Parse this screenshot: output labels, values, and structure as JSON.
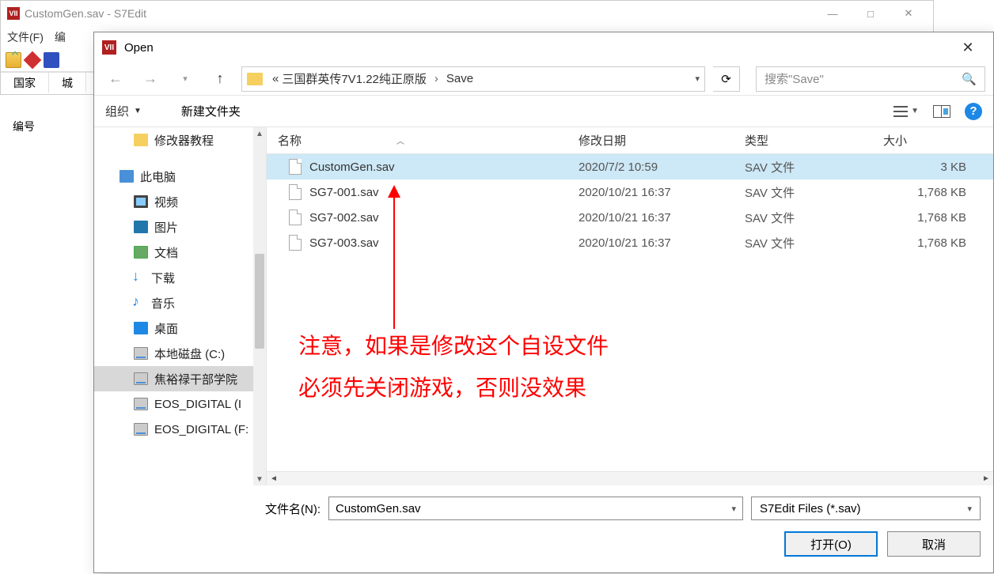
{
  "bg": {
    "title": "CustomGen.sav - S7Edit",
    "menu": {
      "file": "文件(F)",
      "edit": "编"
    },
    "tabs": {
      "t1": "国家",
      "t2": "城"
    },
    "row2": "编号"
  },
  "dialog": {
    "title": "Open",
    "breadcrumb": {
      "prefix": "«",
      "part1": "三国群英传7V1.22纯正原版",
      "part2": "Save"
    },
    "search_placeholder": "搜索\"Save\"",
    "toolbar": {
      "organize": "组织",
      "new_folder": "新建文件夹"
    },
    "tree": {
      "items": [
        {
          "label": "修改器教程",
          "icon": "folder",
          "indent": 2
        },
        {
          "label": "此电脑",
          "icon": "pc",
          "indent": 1
        },
        {
          "label": "视频",
          "icon": "video",
          "indent": 2
        },
        {
          "label": "图片",
          "icon": "pic",
          "indent": 2
        },
        {
          "label": "文档",
          "icon": "doc",
          "indent": 2
        },
        {
          "label": "下载",
          "icon": "dl",
          "indent": 2
        },
        {
          "label": "音乐",
          "icon": "music",
          "indent": 2
        },
        {
          "label": "桌面",
          "icon": "desk",
          "indent": 2
        },
        {
          "label": "本地磁盘 (C:)",
          "icon": "drive",
          "indent": 2
        },
        {
          "label": "焦裕禄干部学院",
          "icon": "drive",
          "indent": 2,
          "sel": true
        },
        {
          "label": "EOS_DIGITAL (I",
          "icon": "drive",
          "indent": 2
        },
        {
          "label": "EOS_DIGITAL (F:",
          "icon": "drive",
          "indent": 2
        }
      ]
    },
    "columns": {
      "name": "名称",
      "date": "修改日期",
      "type": "类型",
      "size": "大小"
    },
    "files": [
      {
        "name": "CustomGen.sav",
        "date": "2020/7/2 10:59",
        "type": "SAV 文件",
        "size": "3 KB",
        "sel": true
      },
      {
        "name": "SG7-001.sav",
        "date": "2020/10/21 16:37",
        "type": "SAV 文件",
        "size": "1,768 KB"
      },
      {
        "name": "SG7-002.sav",
        "date": "2020/10/21 16:37",
        "type": "SAV 文件",
        "size": "1,768 KB"
      },
      {
        "name": "SG7-003.sav",
        "date": "2020/10/21 16:37",
        "type": "SAV 文件",
        "size": "1,768 KB"
      }
    ],
    "annotation": {
      "line1": "注意，如果是修改这个自设文件",
      "line2": "必须先关闭游戏，否则没效果"
    },
    "filename_label": "文件名(N):",
    "filename_value": "CustomGen.sav",
    "filetype": "S7Edit Files (*.sav)",
    "open_btn": "打开(O)",
    "cancel_btn": "取消"
  }
}
